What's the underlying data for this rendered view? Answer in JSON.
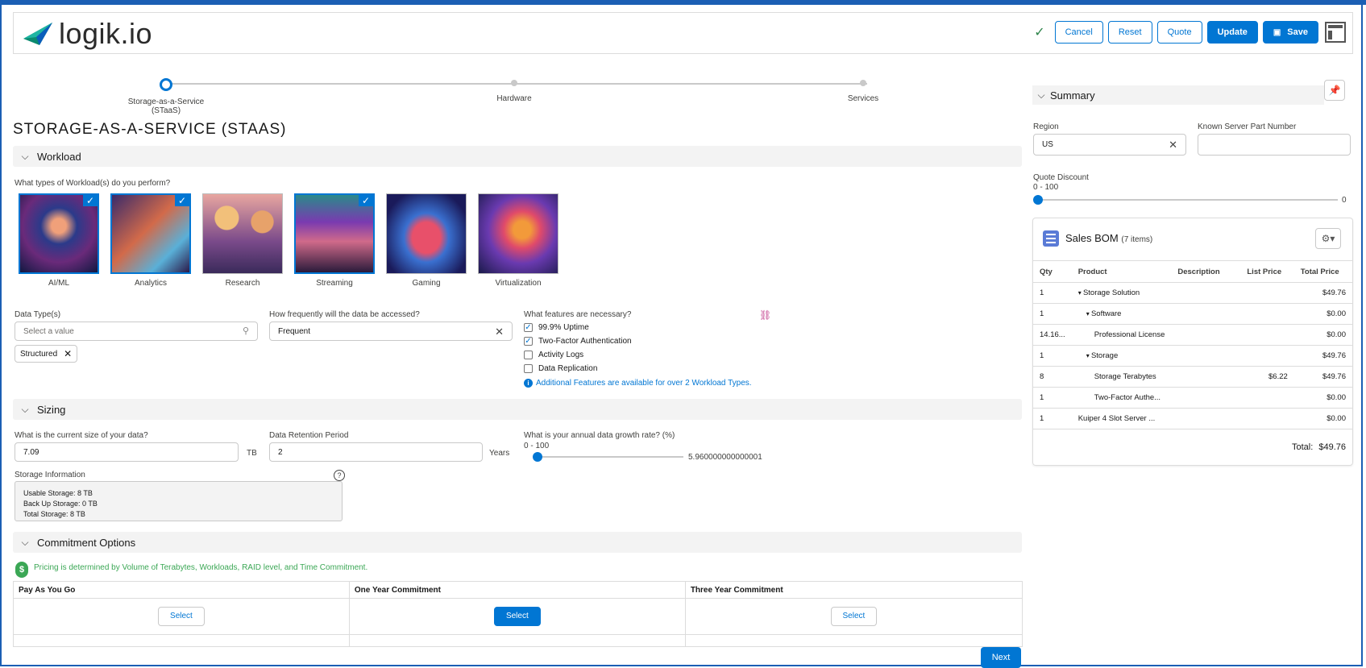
{
  "header": {
    "logo_text": "logik.io",
    "status_icon": "check-icon",
    "buttons": {
      "cancel": "Cancel",
      "reset": "Reset",
      "quote": "Quote",
      "update": "Update",
      "save": "Save"
    }
  },
  "stepper": {
    "steps": [
      "Storage-as-a-Service (STaaS)",
      "Hardware",
      "Services"
    ],
    "active": 0
  },
  "page": {
    "title": "STORAGE-AS-A-SERVICE (STAAS)"
  },
  "workload": {
    "section_title": "Workload",
    "question": "What types of Workload(s) do you perform?",
    "tiles": [
      {
        "label": "AI/ML",
        "selected": true
      },
      {
        "label": "Analytics",
        "selected": true
      },
      {
        "label": "Research",
        "selected": false
      },
      {
        "label": "Streaming",
        "selected": true
      },
      {
        "label": "Gaming",
        "selected": false
      },
      {
        "label": "Virtualization",
        "selected": false
      }
    ],
    "data_type_label": "Data Type(s)",
    "data_type_placeholder": "Select a value",
    "data_type_pill": "Structured",
    "frequency_label": "How frequently will the data be accessed?",
    "frequency_value": "Frequent",
    "features_label": "What features are necessary?",
    "features": [
      {
        "label": "99.9% Uptime",
        "checked": true
      },
      {
        "label": "Two-Factor Authentication",
        "checked": true
      },
      {
        "label": "Activity Logs",
        "checked": false
      },
      {
        "label": "Data Replication",
        "checked": false
      }
    ],
    "info_text": "Additional Features are available for over 2 Workload Types."
  },
  "sizing": {
    "section_title": "Sizing",
    "size_label": "What is the current size of your data?",
    "size_value": "7.09",
    "size_unit": "TB",
    "retention_label": "Data Retention Period",
    "retention_value": "2",
    "retention_unit": "Years",
    "growth_label": "What is your annual data growth rate? (%)",
    "growth_range": "0 - 100",
    "growth_value": "5.960000000000001",
    "storage_info_label": "Storage Information",
    "storage_lines": [
      "Usable Storage: 8 TB",
      "Back Up Storage: 0 TB",
      "Total Storage: 8 TB"
    ]
  },
  "commitment": {
    "section_title": "Commitment Options",
    "pricing_note": "Pricing is determined by Volume of Terabytes, Workloads, RAID level, and Time Commitment.",
    "columns": [
      "Pay As You Go",
      "One Year Commitment",
      "Three Year Commitment"
    ],
    "select_label": "Select",
    "selected_index": 1,
    "next_label": "Next"
  },
  "summary": {
    "title": "Summary",
    "region_label": "Region",
    "region_value": "US",
    "part_label": "Known Server Part Number",
    "part_value": "",
    "discount_label": "Quote Discount",
    "discount_range": "0 - 100",
    "discount_value": "0",
    "bom": {
      "title": "Sales BOM",
      "count": "(7 items)",
      "columns": [
        "Qty",
        "Product",
        "Description",
        "List Price",
        "Total Price"
      ],
      "rows": [
        {
          "qty": "1",
          "product": "Storage Solution",
          "caret": "▾",
          "indent": 0,
          "description": "",
          "list": "",
          "total": "$49.76"
        },
        {
          "qty": "1",
          "product": "Software",
          "caret": "▾",
          "indent": 1,
          "description": "",
          "list": "",
          "total": "$0.00"
        },
        {
          "qty": "14.16...",
          "product": "Professional License",
          "caret": "",
          "indent": 2,
          "description": "",
          "list": "",
          "total": "$0.00"
        },
        {
          "qty": "1",
          "product": "Storage",
          "caret": "▾",
          "indent": 1,
          "description": "",
          "list": "",
          "total": "$49.76"
        },
        {
          "qty": "8",
          "product": "Storage Terabytes",
          "caret": "",
          "indent": 2,
          "description": "",
          "list": "$6.22",
          "total": "$49.76"
        },
        {
          "qty": "1",
          "product": "Two-Factor Authe...",
          "caret": "",
          "indent": 2,
          "description": "",
          "list": "",
          "total": "$0.00"
        },
        {
          "qty": "1",
          "product": "Kuiper 4 Slot Server ...",
          "caret": "",
          "indent": 0,
          "description": "",
          "list": "",
          "total": "$0.00"
        }
      ],
      "total_label": "Total:",
      "total_value": "$49.76"
    }
  },
  "colors": {
    "brand": "#0176d3",
    "success": "#3ba755",
    "border": "#1b5fb4"
  }
}
